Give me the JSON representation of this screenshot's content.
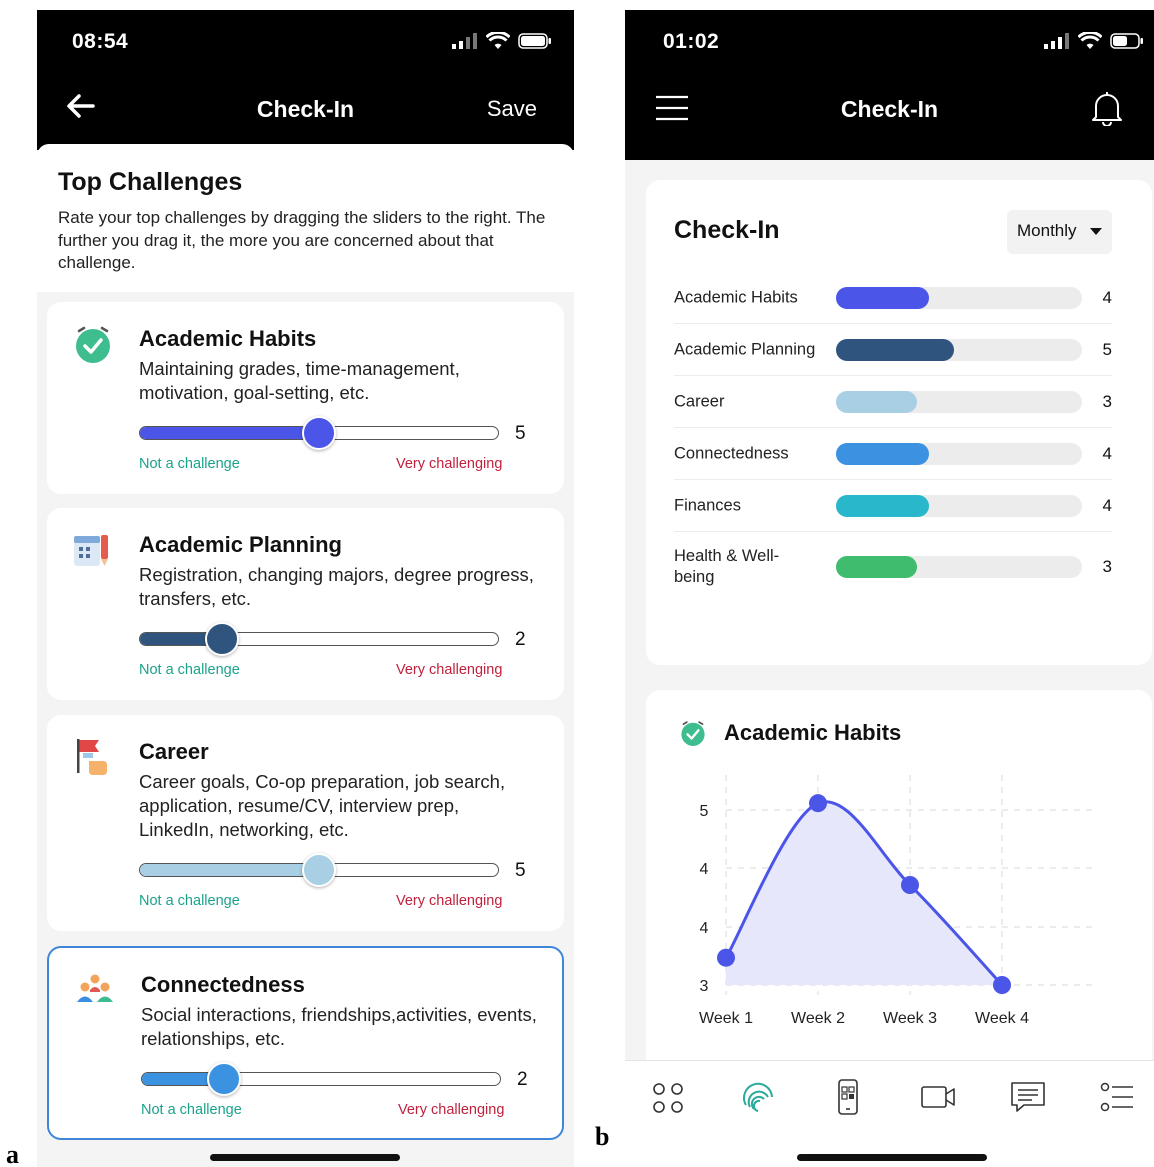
{
  "panel_a": {
    "letter": "a",
    "status_time": "08:54",
    "title": "Check-In",
    "save_label": "Save",
    "section_title": "Top Challenges",
    "section_desc": "Rate your top challenges by dragging the sliders to the right. The further you drag it, the more you are concerned about that challenge.",
    "label_low": "Not a challenge",
    "label_high": "Very challenging",
    "cards": [
      {
        "title": "Academic Habits",
        "desc": "Maintaining grades, time-management, motivation, goal-setting, etc.",
        "value": "5",
        "fraction": 0.5,
        "color": "#4b55e8",
        "icon": "alarm-check-icon"
      },
      {
        "title": "Academic Planning",
        "desc": "Registration, changing majors, degree progress, transfers, etc.",
        "value": "2",
        "fraction": 0.23,
        "color": "#2f557f",
        "icon": "calendar-pen-icon"
      },
      {
        "title": "Career",
        "desc": "Career goals, Co-op preparation, job search, application, resume/CV, interview prep, LinkedIn, networking, etc.",
        "value": "5",
        "fraction": 0.5,
        "color": "#a8cfe3",
        "icon": "flag-hand-icon"
      },
      {
        "title": "Connectedness",
        "desc": "Social interactions, friendships,activities, events, relationships, etc.",
        "value": "2",
        "fraction": 0.23,
        "color": "#3b92e0",
        "icon": "people-group-icon"
      }
    ]
  },
  "panel_b": {
    "letter": "b",
    "status_time": "01:02",
    "title": "Check-In",
    "summary_title": "Check-In",
    "period": "Monthly",
    "bars": [
      {
        "label": "Academic Habits",
        "value": "4",
        "fraction": 0.38,
        "color": "#4b55e8"
      },
      {
        "label": "Academic Planning",
        "value": "5",
        "fraction": 0.48,
        "color": "#2f557f"
      },
      {
        "label": "Career",
        "value": "3",
        "fraction": 0.33,
        "color": "#a8cfe3"
      },
      {
        "label": "Connectedness",
        "value": "4",
        "fraction": 0.38,
        "color": "#3b92e0"
      },
      {
        "label": "Finances",
        "value": "4",
        "fraction": 0.38,
        "color": "#29b7cc"
      },
      {
        "label": "Health & Well-being",
        "value": "3",
        "fraction": 0.33,
        "color": "#3fbc6e"
      }
    ],
    "chart_title": "Academic Habits",
    "nav_icons": [
      "apps-grid-icon",
      "fingerprint-icon",
      "phone-qr-icon",
      "video-camera-icon",
      "chat-message-icon",
      "list-icon"
    ]
  },
  "chart_data": {
    "type": "area",
    "title": "Academic Habits",
    "categories": [
      "Week 1",
      "Week 2",
      "Week 3",
      "Week 4"
    ],
    "y_tick_labels": [
      "3",
      "4",
      "4",
      "5"
    ],
    "values": [
      3.3,
      5.0,
      4.1,
      3.0
    ],
    "ylim": [
      3,
      5.2
    ],
    "grid": true,
    "line_color": "#4b55e8",
    "fill_color": "#e6e7fb"
  }
}
